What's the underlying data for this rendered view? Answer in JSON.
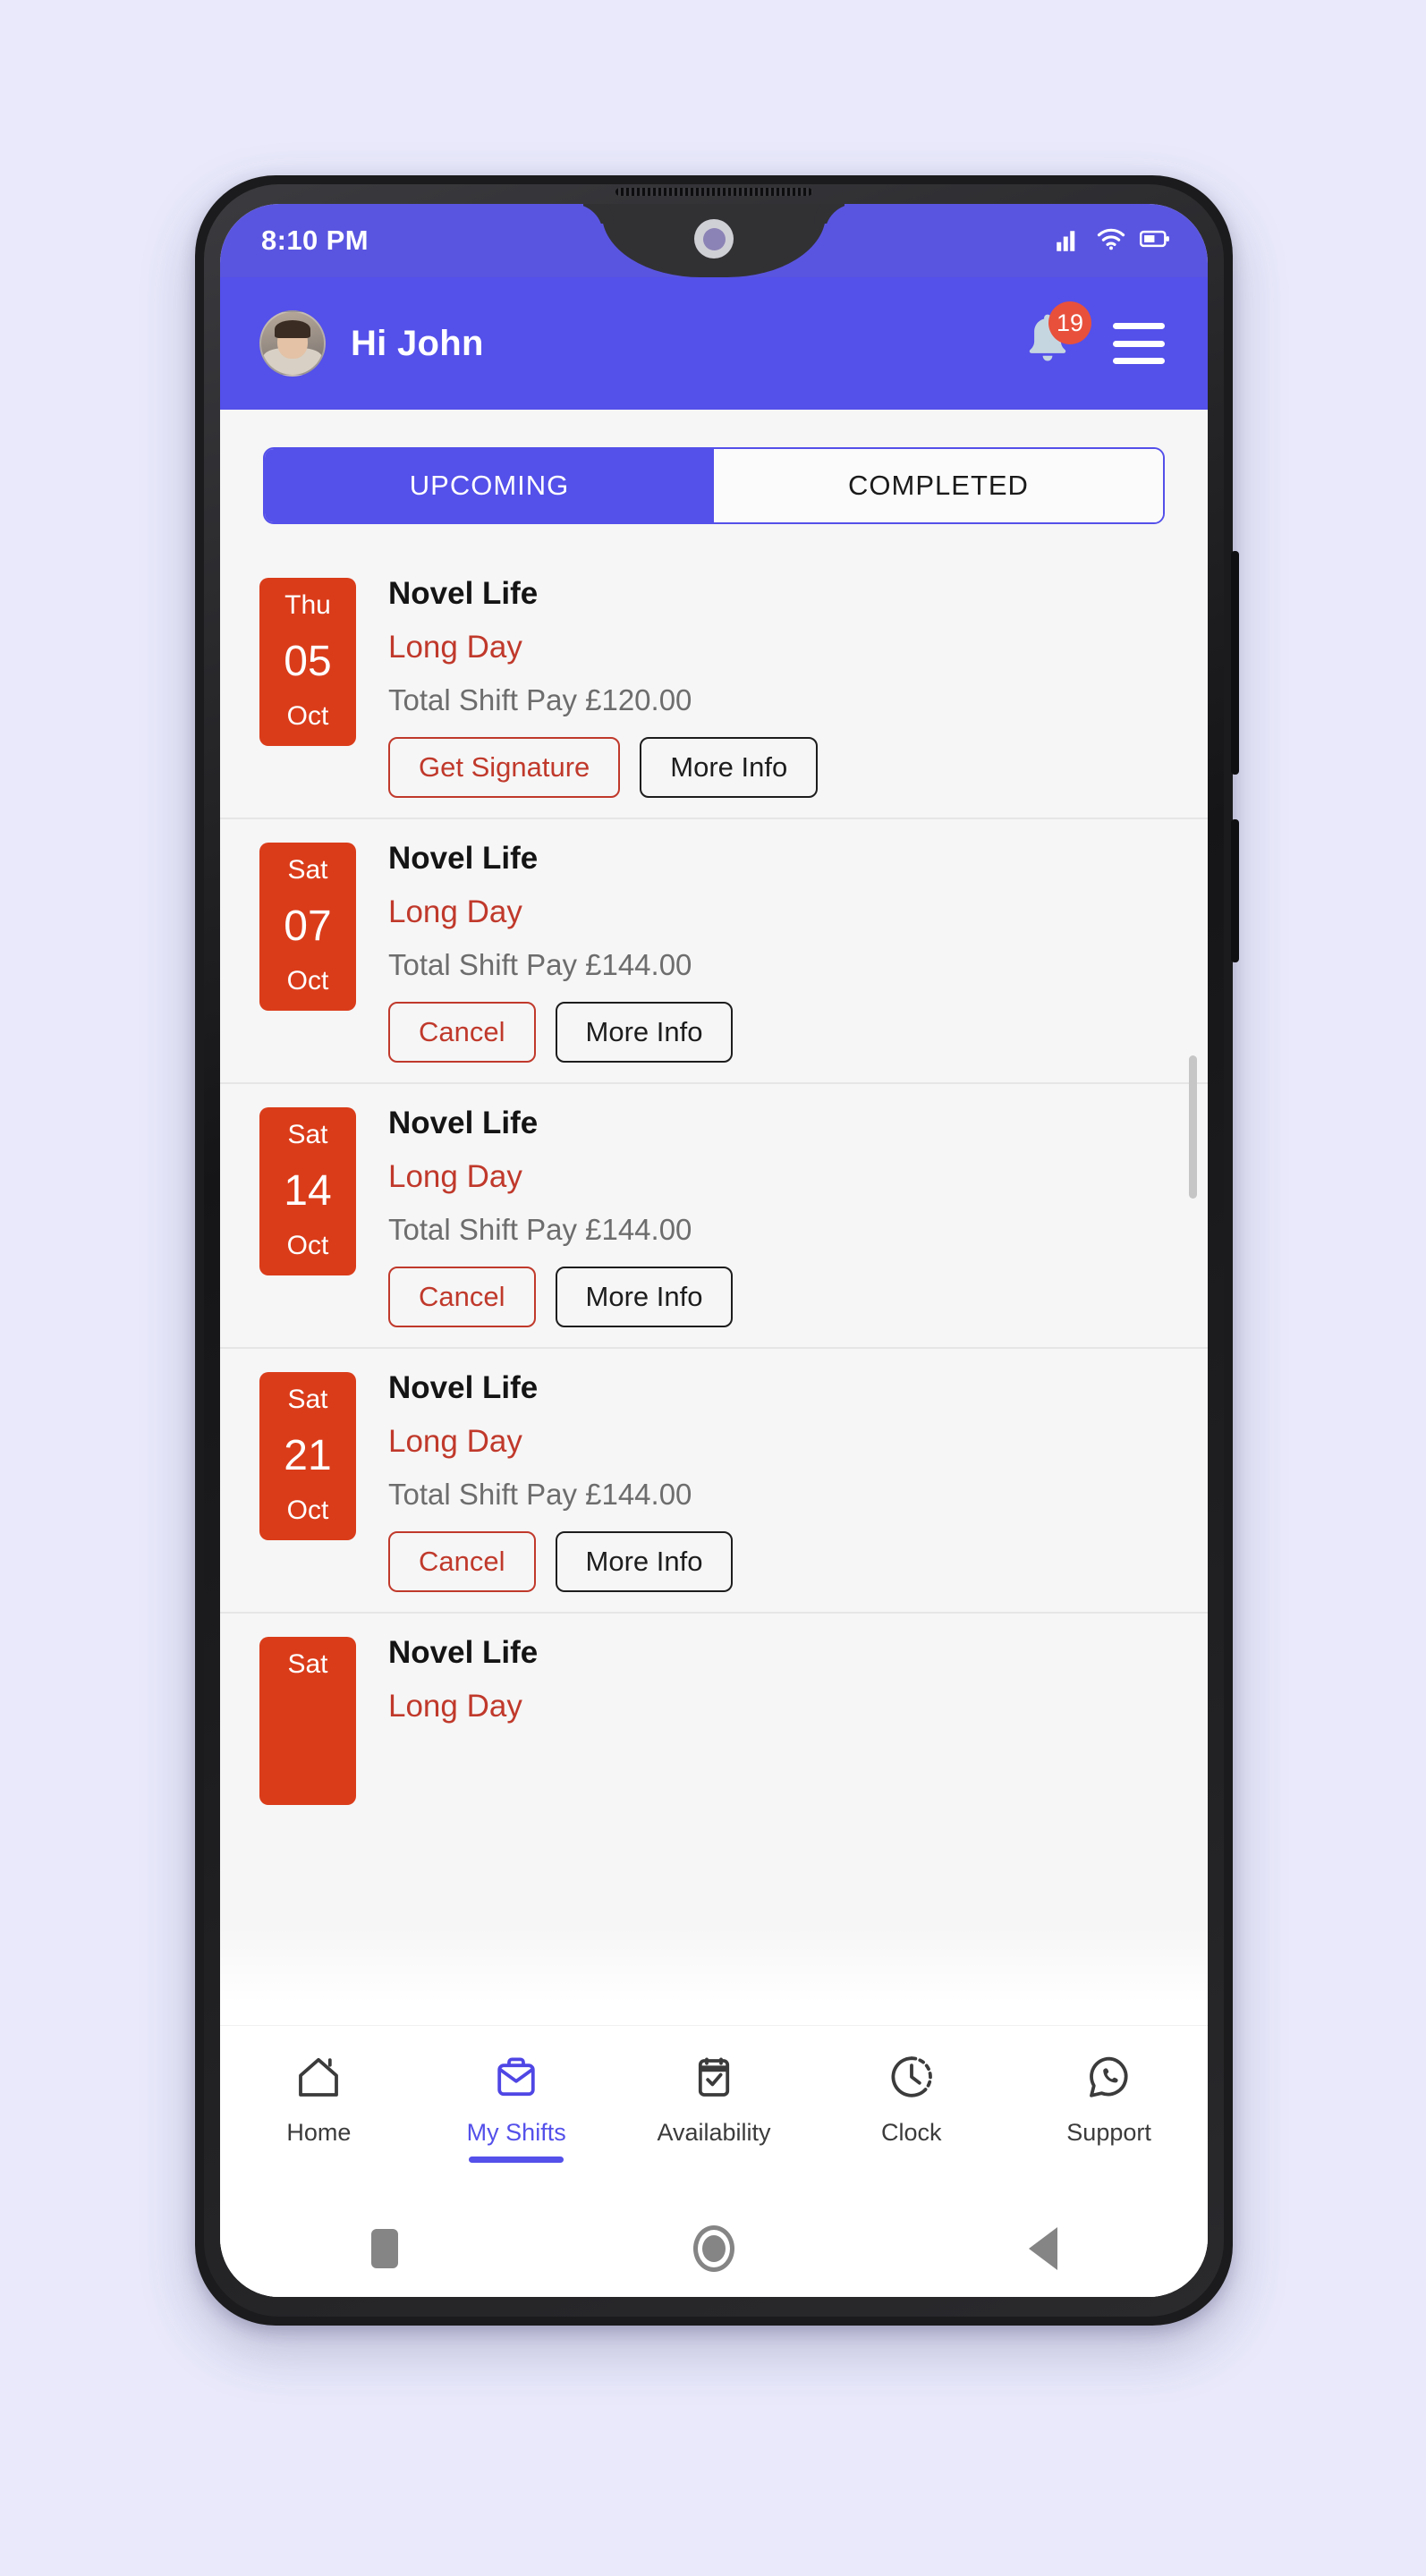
{
  "status_bar": {
    "time": "8:10 PM",
    "icons": [
      "signal-icon",
      "wifi-icon",
      "battery-icon"
    ]
  },
  "header": {
    "greeting": "Hi John",
    "avatar_name": "user-avatar",
    "notification_icon": "bell-icon",
    "notification_count": "19",
    "menu_icon": "hamburger-menu-icon"
  },
  "tabs": [
    {
      "label": "UPCOMING",
      "active": true
    },
    {
      "label": "COMPLETED",
      "active": false
    }
  ],
  "shifts": [
    {
      "weekday": "Thu",
      "day": "05",
      "month": "Oct",
      "company": "Novel Life",
      "type": "Long Day",
      "pay": "Total Shift Pay £120.00",
      "primary_action": "Get Signature",
      "secondary_action": "More Info"
    },
    {
      "weekday": "Sat",
      "day": "07",
      "month": "Oct",
      "company": "Novel Life",
      "type": "Long Day",
      "pay": "Total Shift Pay £144.00",
      "primary_action": "Cancel",
      "secondary_action": "More Info"
    },
    {
      "weekday": "Sat",
      "day": "14",
      "month": "Oct",
      "company": "Novel Life",
      "type": "Long Day",
      "pay": "Total Shift Pay £144.00",
      "primary_action": "Cancel",
      "secondary_action": "More Info"
    },
    {
      "weekday": "Sat",
      "day": "21",
      "month": "Oct",
      "company": "Novel Life",
      "type": "Long Day",
      "pay": "Total Shift Pay £144.00",
      "primary_action": "Cancel",
      "secondary_action": "More Info"
    }
  ],
  "partial_shift": {
    "weekday": "Sat",
    "company": "Novel Life",
    "type": "Long Day"
  },
  "bottom_nav": [
    {
      "label": "Home",
      "icon": "home-icon",
      "active": false
    },
    {
      "label": "My Shifts",
      "icon": "briefcase-icon",
      "active": true
    },
    {
      "label": "Availability",
      "icon": "calendar-check-icon",
      "active": false
    },
    {
      "label": "Clock",
      "icon": "clock-icon",
      "active": false
    },
    {
      "label": "Support",
      "icon": "whatsapp-chat-icon",
      "active": false
    }
  ],
  "system_nav": [
    {
      "icon": "recents-square-icon"
    },
    {
      "icon": "home-circle-icon"
    },
    {
      "icon": "back-triangle-icon"
    }
  ],
  "colors": {
    "header_purple": "#5450ea",
    "status_purple": "#5a55e0",
    "date_badge_red": "#da3c1a",
    "accent_red": "#c0392b",
    "badge_red": "#e8503c",
    "content_bg": "#f6f6f6"
  }
}
